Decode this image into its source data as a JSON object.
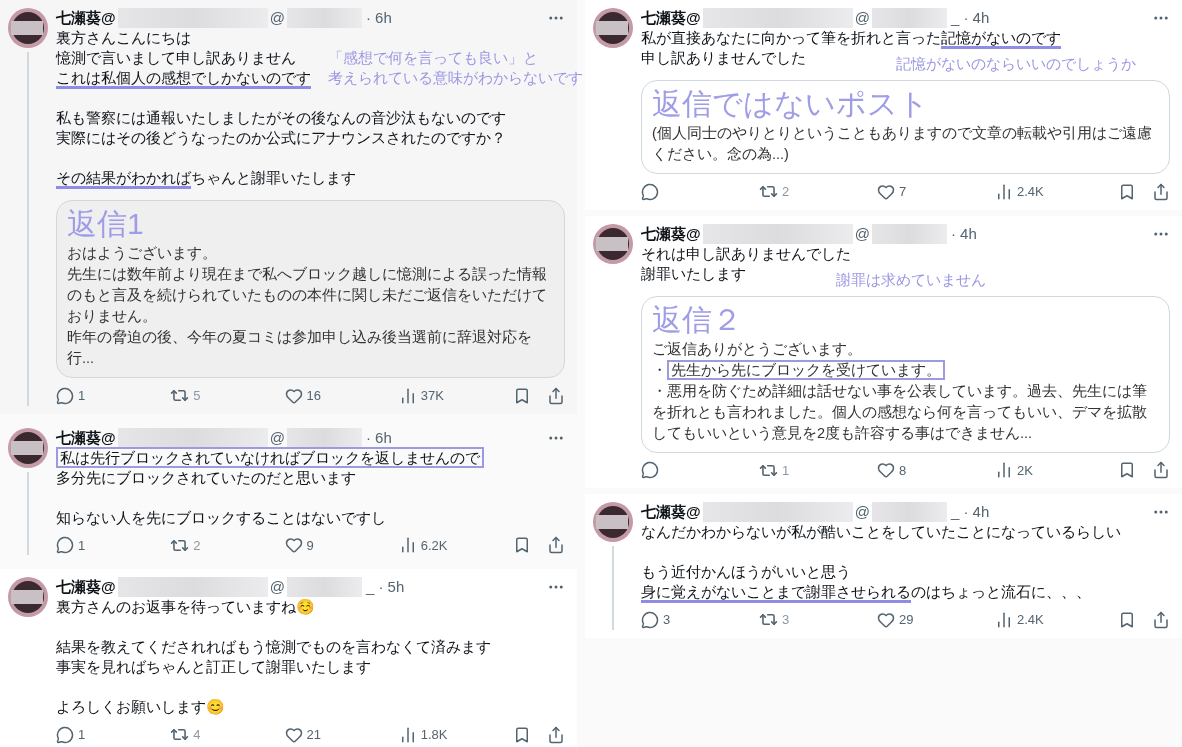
{
  "columns": [
    {
      "posts": [
        {
          "name": "七瀬葵@",
          "at": "@",
          "time": "· 6h",
          "thread_line": true,
          "paragraphs": [
            [
              {
                "parts": [
                  {
                    "text": "裏方さんこんにちは"
                  }
                ]
              },
              {
                "parts": [
                  {
                    "text": "憶測で言いまして申し訳ありません"
                  }
                ],
                "note": [
                  "「感想で何を言っても良い」と",
                  "考えられている意味がわからないです"
                ]
              },
              {
                "parts": [
                  {
                    "text": "これは私個人の感想でしかないのです",
                    "underlined": true
                  }
                ]
              }
            ],
            [
              {
                "parts": [
                  {
                    "text": "私も警察には通報いたしましたがその後なんの音沙汰もないのです"
                  }
                ]
              },
              {
                "parts": [
                  {
                    "text": "実際にはその後どうなったのか公式にアナウンスされたのですか？"
                  }
                ]
              }
            ],
            [
              {
                "parts": [
                  {
                    "text": "その結果がわかれば",
                    "underlined": true
                  },
                  {
                    "text": "ちゃんと謝罪いたします"
                  }
                ]
              }
            ]
          ],
          "card": {
            "title": "返信1",
            "lines": [
              [
                {
                  "text": "おはようございます。"
                }
              ],
              [
                {
                  "text": "先生には数年前より現在まで私へブロック越しに憶測による誤った情報のもと言及を続けられていたものの本件に関し未だご返信をいただけておりません。"
                }
              ],
              [
                {
                  "text": "昨年の脅迫の後、今年の夏コミは参加申し込み後当選前に辞退対応を行..."
                }
              ]
            ]
          },
          "stats": {
            "replies": "1",
            "reposts": "5",
            "likes": "16",
            "views": "37K"
          }
        },
        {
          "name": "七瀬葵@",
          "at": "@",
          "time": "· 6h",
          "thread_line": true,
          "paragraphs": [
            [
              {
                "parts": [
                  {
                    "text": "私は先行ブロックされていなければブロックを返しませんので",
                    "boxed": true
                  }
                ]
              },
              {
                "parts": [
                  {
                    "text": "多分先にブロックされていたのだと思います"
                  }
                ]
              }
            ],
            [
              {
                "parts": [
                  {
                    "text": "知らない人を先にブロックすることはないですし"
                  }
                ]
              }
            ]
          ],
          "stats": {
            "replies": "1",
            "reposts": "2",
            "likes": "9",
            "views": "6.2K"
          }
        },
        {
          "name": "七瀬葵@",
          "at": "@",
          "time": "_ · 5h",
          "thread_line": false,
          "paragraphs": [
            [
              {
                "parts": [
                  {
                    "text": "裏方さんのお返事を待っていますね☺️"
                  }
                ]
              }
            ],
            [
              {
                "parts": [
                  {
                    "text": "結果を教えてくだされればもう憶測でものを言わなくて済みます"
                  }
                ]
              },
              {
                "parts": [
                  {
                    "text": "事実を見ればちゃんと訂正して謝罪いたします"
                  }
                ]
              }
            ],
            [
              {
                "parts": [
                  {
                    "text": "よろしくお願いします😊"
                  }
                ]
              }
            ]
          ],
          "stats": {
            "replies": "1",
            "reposts": "4",
            "likes": "21",
            "views": "1.8K"
          }
        }
      ]
    },
    {
      "posts": [
        {
          "name": "七瀬葵@",
          "at": "@",
          "time": "_ · 4h",
          "thread_line": false,
          "paragraphs": [
            [
              {
                "parts": [
                  {
                    "text": "私が直接あなたに向かって筆を折れと言った"
                  },
                  {
                    "text": "記憶がないのです",
                    "underlined": true
                  }
                ]
              },
              {
                "parts": [
                  {
                    "text": "申し訳ありませんでした"
                  }
                ],
                "note": [
                  "記憶がないのならいいのでしょうか"
                ]
              }
            ]
          ],
          "card": {
            "title": "返信ではないポスト",
            "lines": [
              [
                {
                  "text": "(個人同士のやりとりということもありますので文章の転載や引用はご遠慮ください。念の為...)"
                }
              ]
            ]
          },
          "stats": {
            "reposts": "2",
            "likes": "7",
            "views": "2.4K"
          }
        },
        {
          "name": "七瀬葵@",
          "at": "@",
          "time": "· 4h",
          "thread_line": false,
          "paragraphs": [
            [
              {
                "parts": [
                  {
                    "text": "それは申し訳ありませんでした"
                  }
                ]
              },
              {
                "parts": [
                  {
                    "text": "謝罪いたします"
                  }
                ],
                "note": [
                  "謝罪は求めていません"
                ]
              }
            ]
          ],
          "card": {
            "title": "返信２",
            "lines": [
              [
                {
                  "text": "ご返信ありがとうございます。"
                }
              ],
              [
                {
                  "text": "・"
                },
                {
                  "text": "先生から先にブロックを受けています。",
                  "boxed": true
                }
              ],
              [
                {
                  "text": "・悪用を防ぐため詳細は話せない事を公表しています。過去、先生には筆を折れとも言われました。個人の感想なら何を言ってもいい、デマを拡散してもいいという意見を2度も許容する事はできません..."
                }
              ]
            ]
          },
          "stats": {
            "reposts": "1",
            "likes": "8",
            "views": "2K"
          }
        },
        {
          "name": "七瀬葵@",
          "at": "@",
          "time": "_ · 4h",
          "thread_line": true,
          "paragraphs": [
            [
              {
                "parts": [
                  {
                    "text": "なんだかわからないが私が酷いことをしていたことになっているらしい"
                  }
                ]
              }
            ],
            [
              {
                "parts": [
                  {
                    "text": "もう近付かんほうがいいと思う"
                  }
                ]
              },
              {
                "parts": [
                  {
                    "text": "身に覚えがないことまで謝罪させられる",
                    "underlined": true
                  },
                  {
                    "text": "のはちょっと流石に、、、"
                  }
                ]
              }
            ]
          ],
          "stats": {
            "replies": "3",
            "reposts": "3",
            "likes": "29",
            "views": "2.4K"
          }
        }
      ]
    }
  ]
}
